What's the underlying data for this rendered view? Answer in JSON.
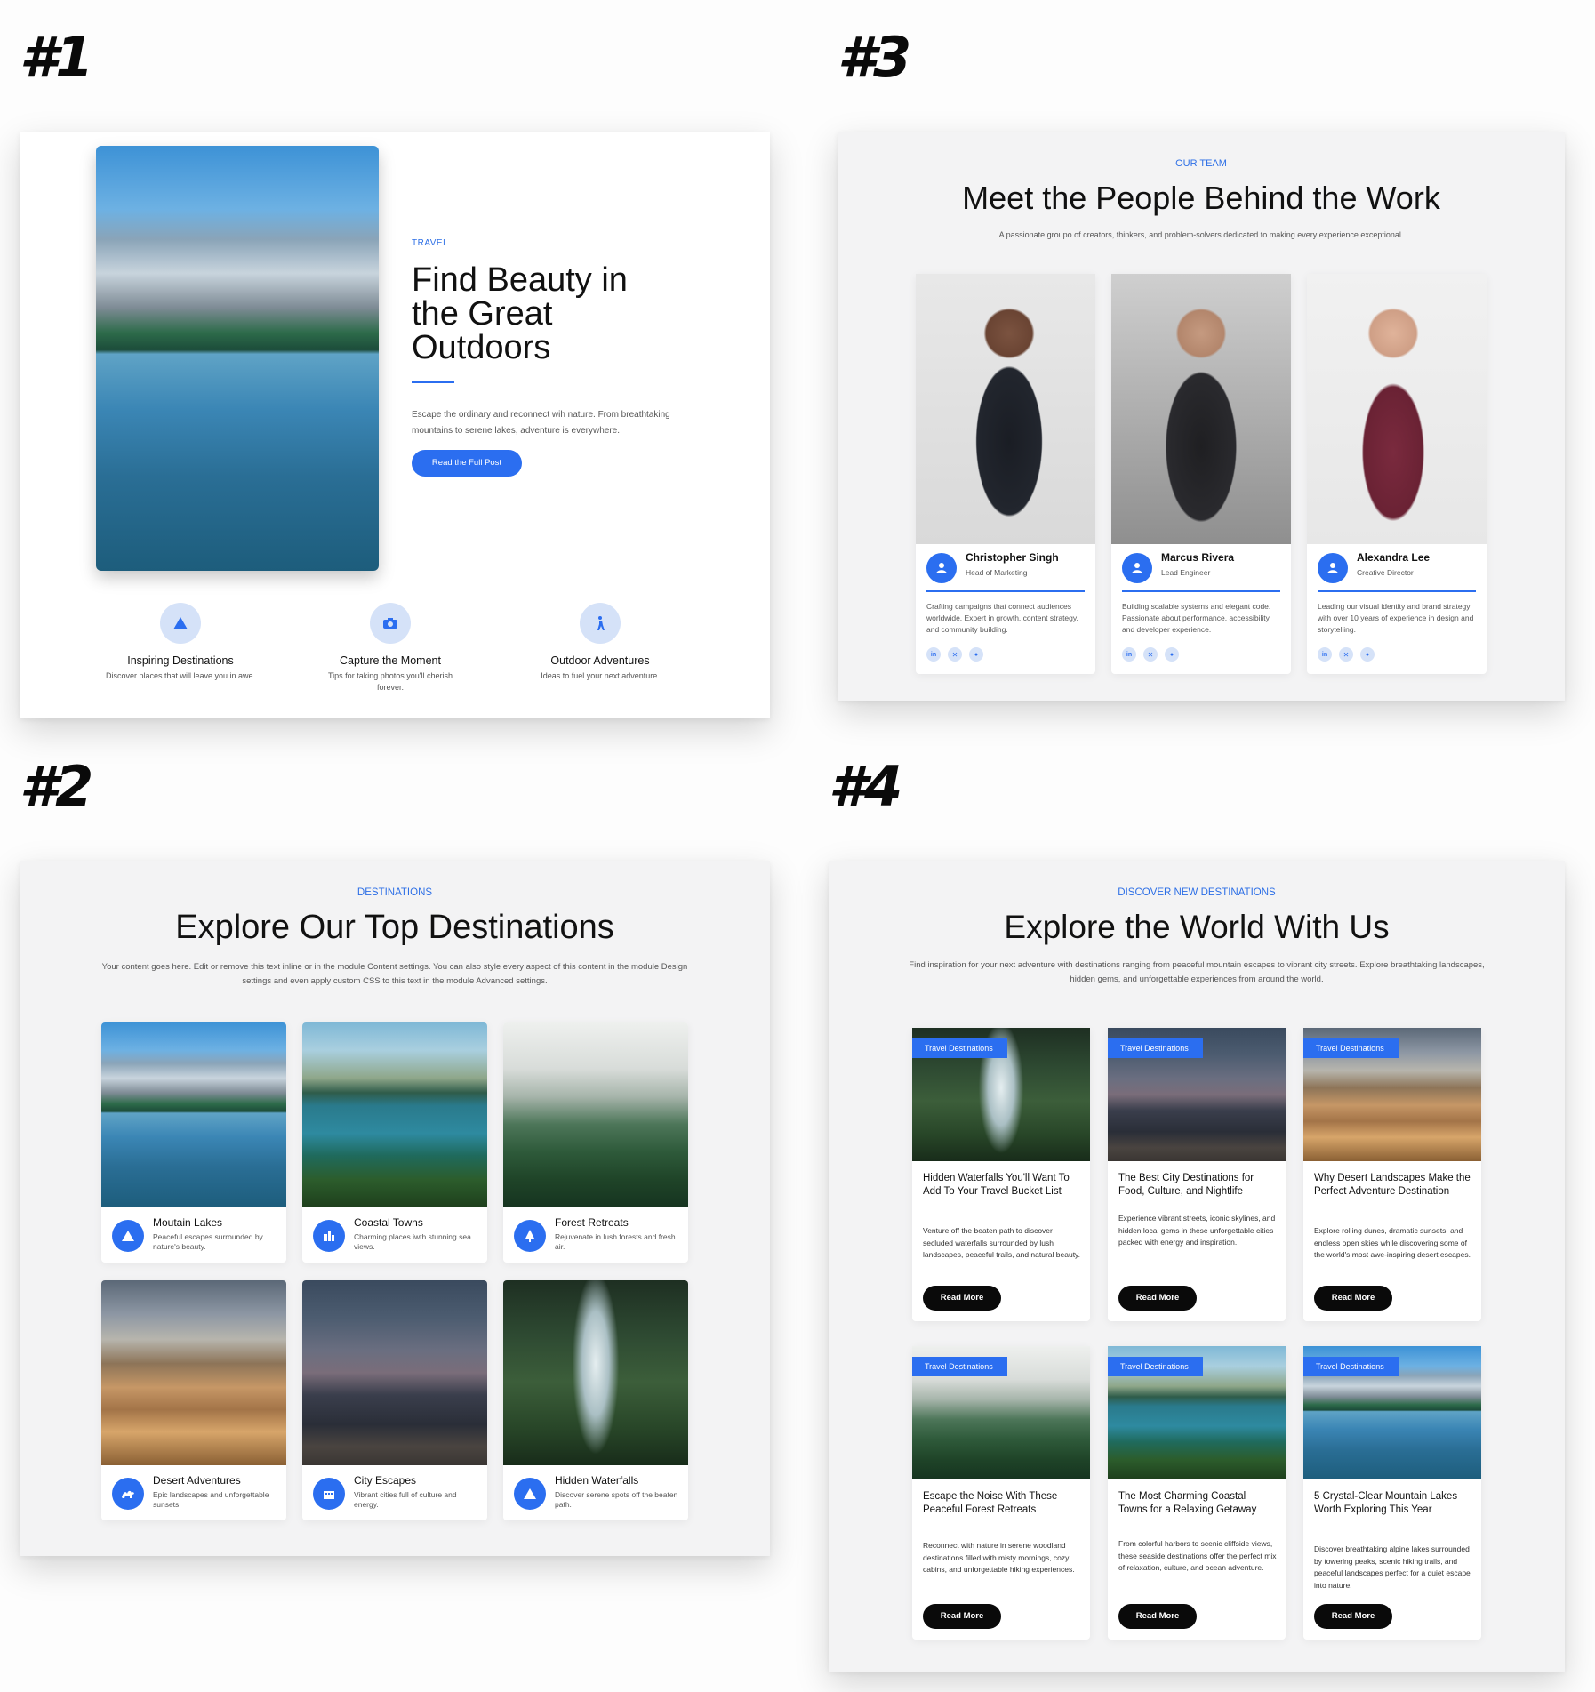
{
  "labels": {
    "p1": "#1",
    "p2": "#2",
    "p3": "#3",
    "p4": "#4"
  },
  "colors": {
    "accent": "#2b6ef0",
    "dark_button": "#0a0a0a",
    "panel_bg": "#f3f3f4"
  },
  "section1": {
    "eyebrow": "TRAVEL",
    "title": "Find Beauty in the Great Outdoors",
    "body": "Escape the ordinary and reconnect wih nature. From breathtaking mountains to serene lakes, adventure is everywhere.",
    "cta": "Read the Full Post",
    "image": "mountain-lake-photo",
    "features": [
      {
        "icon": "mountain-icon",
        "title": "Inspiring Destinations",
        "desc": "Discover places that will leave you in awe."
      },
      {
        "icon": "camera-icon",
        "title": "Capture the Moment",
        "desc": "Tips for taking photos you'll cherish forever."
      },
      {
        "icon": "hiker-icon",
        "title": "Outdoor Adventures",
        "desc": "Ideas to fuel your next adventure."
      }
    ]
  },
  "section2": {
    "eyebrow": "DESTINATIONS",
    "title": "Explore Our Top Destinations",
    "body": "Your content goes here. Edit or remove this text inline or in the module Content settings. You can also style every aspect of this content in the module Design settings and even apply custom CSS to this text in the module Advanced settings.",
    "cards": [
      {
        "title": "Moutain Lakes",
        "desc": "Peaceful escapes surrounded by nature's beauty.",
        "icon": "mountain-icon",
        "image": "mountain-lake-photo"
      },
      {
        "title": "Coastal Towns",
        "desc": "Charming places iwth stunning sea views.",
        "icon": "buildings-icon",
        "image": "coastal-town-photo"
      },
      {
        "title": "Forest Retreats",
        "desc": "Rejuvenate in lush forests and fresh air.",
        "icon": "tree-icon",
        "image": "misty-forest-photo"
      },
      {
        "title": "Desert Adventures",
        "desc": "Epic landscapes and unforgettable sunsets.",
        "icon": "camel-icon",
        "image": "desert-dunes-photo"
      },
      {
        "title": "City Escapes",
        "desc": "Vibrant cities full of culture and energy.",
        "icon": "city-icon",
        "image": "city-street-photo"
      },
      {
        "title": "Hidden Waterfalls",
        "desc": "Discover serene spots off the beaten path.",
        "icon": "mountain-icon",
        "image": "waterfall-photo"
      }
    ]
  },
  "section3": {
    "eyebrow": "OUR TEAM",
    "title": "Meet the People Behind the Work",
    "body": "A passionate groupo of creators, thinkers, and problem-solvers dedicated to making every experience exceptional.",
    "members": [
      {
        "name": "Christopher Singh",
        "role": "Head of Marketing",
        "bio": "Crafting campaigns that connect audiences worldwide. Expert in growth, content strategy, and community building.",
        "image": "portrait-christopher"
      },
      {
        "name": "Marcus Rivera",
        "role": "Lead Engineer",
        "bio": "Building scalable systems and elegant code. Passionate about performance, accessibility, and developer experience.",
        "image": "portrait-marcus"
      },
      {
        "name": "Alexandra Lee",
        "role": "Creative Director",
        "bio": "Leading our visual identity and brand strategy with over 10 years of experience in design and storytelling.",
        "image": "portrait-alexandra"
      }
    ],
    "social_icons": [
      "linkedin-icon",
      "x-icon",
      "reddit-icon"
    ]
  },
  "section4": {
    "eyebrow": "DISCOVER NEW DESTINATIONS",
    "title": "Explore the World With Us",
    "body": "Find inspiration for your next adventure with destinations ranging from peaceful mountain escapes to vibrant city streets. Explore breathtaking landscapes, hidden gems, and unforgettable experiences from around the world.",
    "tag": "Travel Destinations",
    "button": "Read More",
    "posts": [
      {
        "title": "Hidden Waterfalls You'll Want To Add To Your Travel Bucket List",
        "body": "Venture off the beaten path to discover secluded waterfalls surrounded by lush landscapes, peaceful trails, and natural beauty.",
        "image": "waterfall-photo"
      },
      {
        "title": "The Best City Destinations for Food, Culture, and Nightlife",
        "body": "Experience vibrant streets, iconic skylines, and hidden local gems in these unforgettable cities packed with energy and inspiration.",
        "image": "city-street-photo"
      },
      {
        "title": "Why Desert Landscapes Make the Perfect Adventure Destination",
        "body": "Explore rolling dunes, dramatic sunsets, and endless open skies while discovering some of the world's most awe-inspiring desert escapes.",
        "image": "desert-dunes-photo"
      },
      {
        "title": "Escape the Noise With These Peaceful Forest Retreats",
        "body": "Reconnect with nature in serene woodland destinations filled with misty mornings, cozy cabins, and unforgettable hiking experiences.",
        "image": "misty-forest-photo"
      },
      {
        "title": "The Most Charming Coastal Towns for a Relaxing Getaway",
        "body": "From colorful harbors to scenic cliffside views, these seaside destinations offer the perfect mix of relaxation, culture, and ocean adventure.",
        "image": "coastal-town-photo"
      },
      {
        "title": "5 Crystal-Clear Mountain Lakes Worth Exploring This Year",
        "body": "Discover breathtaking alpine lakes surrounded by towering peaks, scenic hiking trails, and peaceful landscapes perfect for a quiet escape into nature.",
        "image": "mountain-lake-photo"
      }
    ]
  }
}
